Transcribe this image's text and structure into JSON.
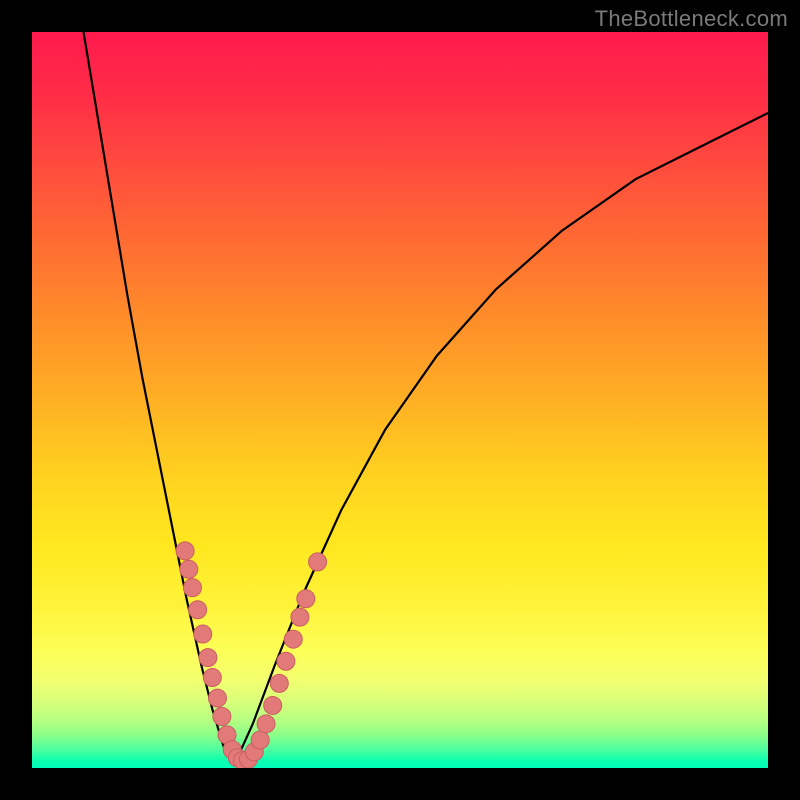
{
  "watermark": "TheBottleneck.com",
  "chart_data": {
    "type": "line",
    "title": "",
    "xlabel": "",
    "ylabel": "",
    "xlim": [
      0,
      100
    ],
    "ylim": [
      0,
      100
    ],
    "grid": false,
    "legend": false,
    "series": [
      {
        "name": "bottleneck-curve-left",
        "x": [
          7,
          9,
          11,
          13,
          15,
          17,
          19,
          21,
          23,
          24.5,
          26,
          27.5
        ],
        "values": [
          100,
          88,
          76,
          64,
          53,
          43,
          33,
          23,
          14,
          8,
          3,
          0.5
        ]
      },
      {
        "name": "bottleneck-curve-right",
        "x": [
          27.5,
          30,
          33,
          37,
          42,
          48,
          55,
          63,
          72,
          82,
          92,
          100
        ],
        "values": [
          0.5,
          6,
          14,
          24,
          35,
          46,
          56,
          65,
          73,
          80,
          85,
          89
        ]
      },
      {
        "name": "marker-dots",
        "type": "scatter",
        "points": [
          {
            "x": 20.8,
            "y": 29.5
          },
          {
            "x": 21.3,
            "y": 27.0
          },
          {
            "x": 21.8,
            "y": 24.5
          },
          {
            "x": 22.5,
            "y": 21.5
          },
          {
            "x": 23.2,
            "y": 18.2
          },
          {
            "x": 23.9,
            "y": 15.0
          },
          {
            "x": 24.5,
            "y": 12.3
          },
          {
            "x": 25.2,
            "y": 9.5
          },
          {
            "x": 25.8,
            "y": 7.0
          },
          {
            "x": 26.5,
            "y": 4.5
          },
          {
            "x": 27.2,
            "y": 2.5
          },
          {
            "x": 27.9,
            "y": 1.4
          },
          {
            "x": 28.6,
            "y": 1.0
          },
          {
            "x": 29.4,
            "y": 1.2
          },
          {
            "x": 30.2,
            "y": 2.2
          },
          {
            "x": 31.0,
            "y": 3.8
          },
          {
            "x": 31.8,
            "y": 6.0
          },
          {
            "x": 32.7,
            "y": 8.5
          },
          {
            "x": 33.6,
            "y": 11.5
          },
          {
            "x": 34.5,
            "y": 14.5
          },
          {
            "x": 35.5,
            "y": 17.5
          },
          {
            "x": 36.4,
            "y": 20.5
          },
          {
            "x": 37.2,
            "y": 23.0
          },
          {
            "x": 38.8,
            "y": 28.0
          }
        ]
      }
    ],
    "colors": {
      "curve": "#000000",
      "dots": "#e37a7a",
      "dots_stroke": "#c95e5e"
    }
  }
}
